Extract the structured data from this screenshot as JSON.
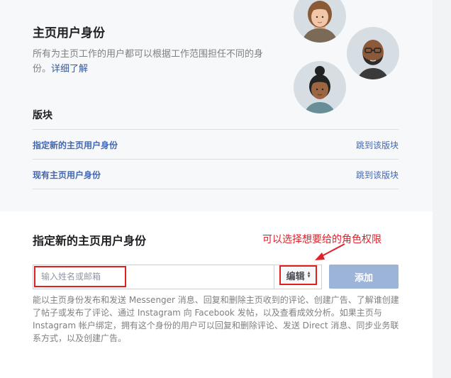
{
  "roles": {
    "title": "主页用户身份",
    "description": "所有为主页工作的用户都可以根据工作范围担任不同的身份。",
    "learn_more": "详细了解"
  },
  "sections": {
    "label": "版块",
    "rows": [
      {
        "label": "指定新的主页用户身份",
        "jump": "跳到该版块"
      },
      {
        "label": "现有主页用户身份",
        "jump": "跳到该版块"
      }
    ]
  },
  "assign": {
    "title": "指定新的主页用户身份",
    "annotation": "可以选择想要给的角色权限",
    "name_placeholder": "输入姓名或邮箱",
    "role_value": "编辑",
    "add_label": "添加",
    "help_text": "能以主页身份发布和发送 Messenger 消息、回复和删除主页收到的评论、创建广告、了解谁创建了帖子或发布了评论、通过 Instagram 向 Facebook 发帖，以及查看成效分析。如果主页与 Instagram 帐户绑定，拥有这个身份的用户可以回复和删除评论、发送 Direct 消息、同步业务联系方式，以及创建广告。"
  },
  "colors": {
    "link": "#4267b2",
    "annotation": "#e0202a",
    "add_button": "#9cb4d8"
  }
}
